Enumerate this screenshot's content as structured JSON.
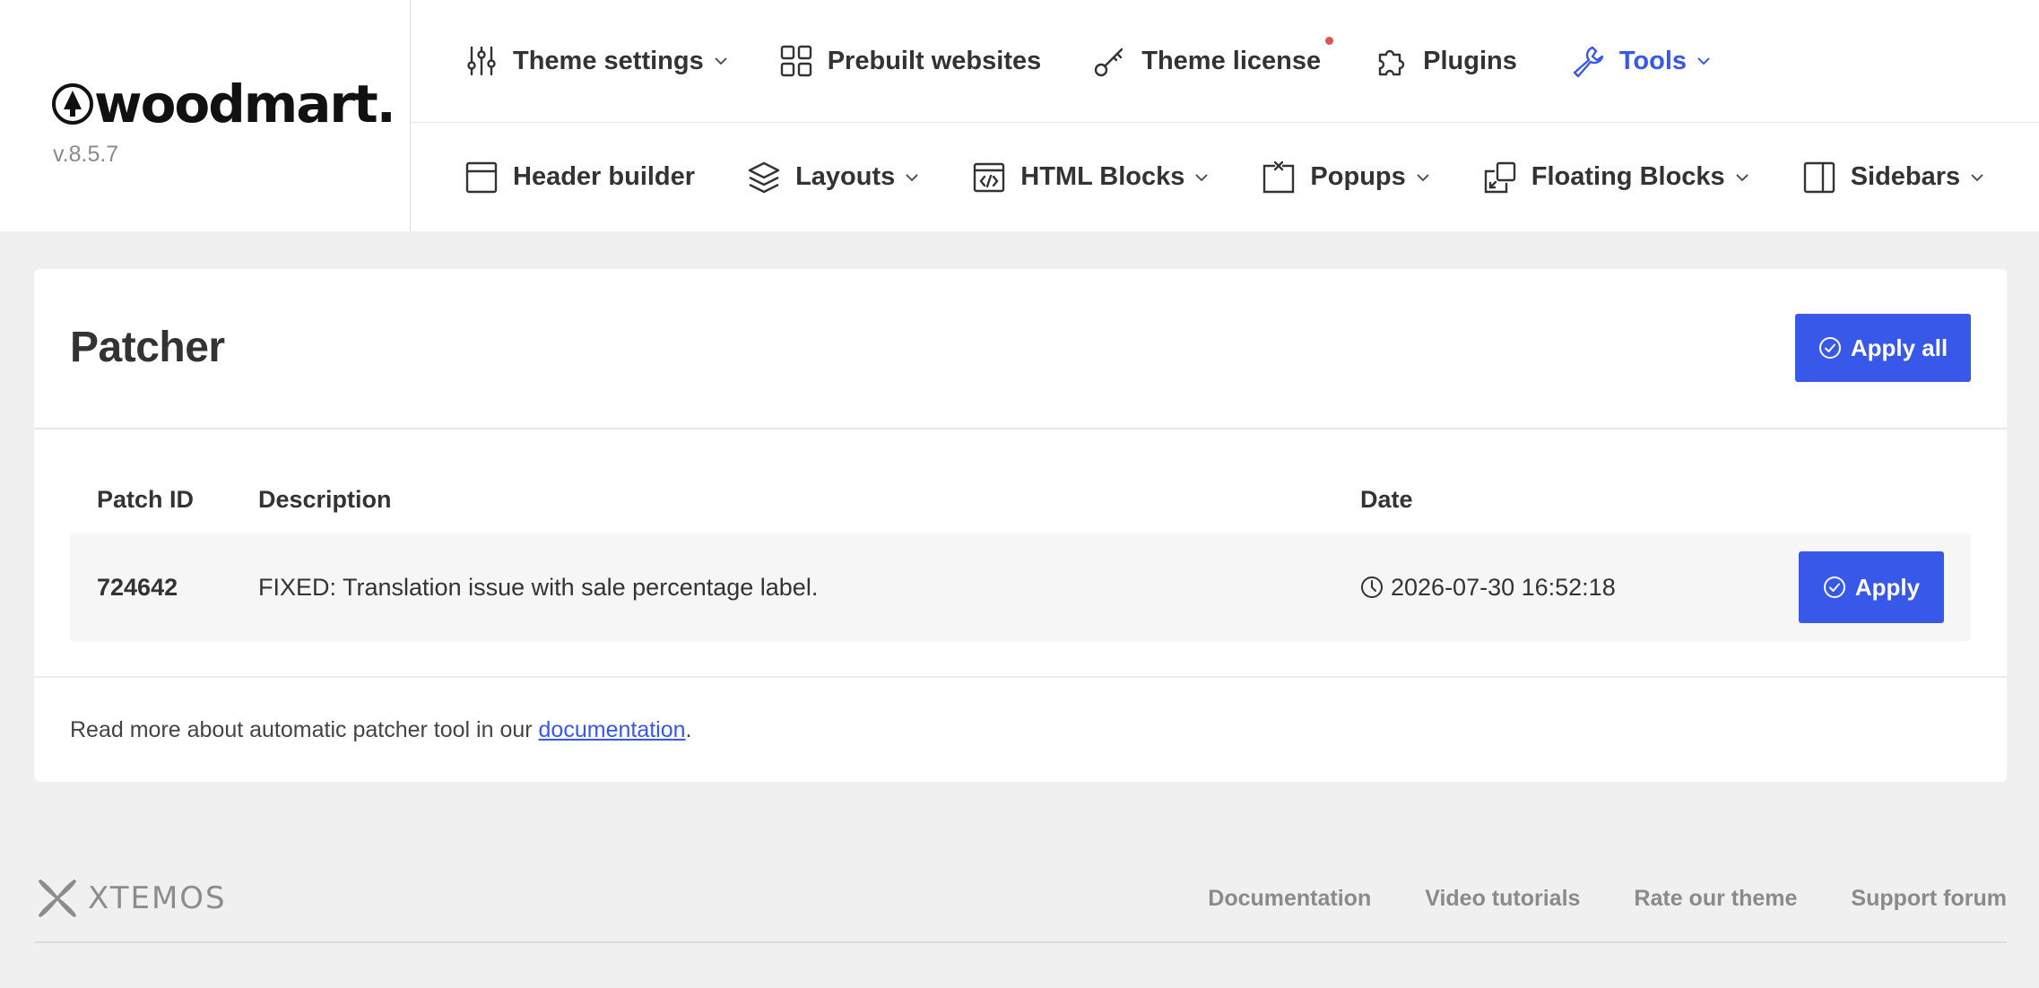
{
  "brand": {
    "name": "woodmart.",
    "version": "v.8.5.7"
  },
  "nav": {
    "row1": [
      {
        "label": "Theme settings",
        "icon": "sliders-icon"
      },
      {
        "label": "Prebuilt websites",
        "icon": "grid-icon"
      },
      {
        "label": "Theme license",
        "icon": "key-icon"
      },
      {
        "label": "Plugins",
        "icon": "puzzle-icon"
      },
      {
        "label": "Tools",
        "icon": "wrench-icon"
      }
    ],
    "row2": [
      {
        "label": "Header builder",
        "icon": "header-icon"
      },
      {
        "label": "Layouts",
        "icon": "layers-icon"
      },
      {
        "label": "HTML Blocks",
        "icon": "code-icon"
      },
      {
        "label": "Popups",
        "icon": "popup-icon"
      },
      {
        "label": "Floating Blocks",
        "icon": "floating-icon"
      },
      {
        "label": "Sidebars",
        "icon": "sidebar-icon"
      }
    ]
  },
  "page": {
    "title": "Patcher",
    "apply_all_label": "Apply all"
  },
  "table": {
    "headers": [
      "Patch ID",
      "Description",
      "Date"
    ],
    "rows": [
      {
        "id": "724642",
        "description": "FIXED: Translation issue with sale percentage label.",
        "date": "2026-07-30 16:52:18",
        "action": "Apply"
      }
    ]
  },
  "footnote": {
    "prefix": "Read more about automatic patcher tool in our ",
    "link": "documentation",
    "suffix": "."
  },
  "footer": {
    "logo_text": "XTEMOS",
    "links": [
      "Documentation",
      "Video tutorials",
      "Rate our theme",
      "Support forum"
    ]
  },
  "colors": {
    "accent": "#3858e9",
    "notification_dot": "#e05252",
    "background": "#f0f0f0"
  }
}
